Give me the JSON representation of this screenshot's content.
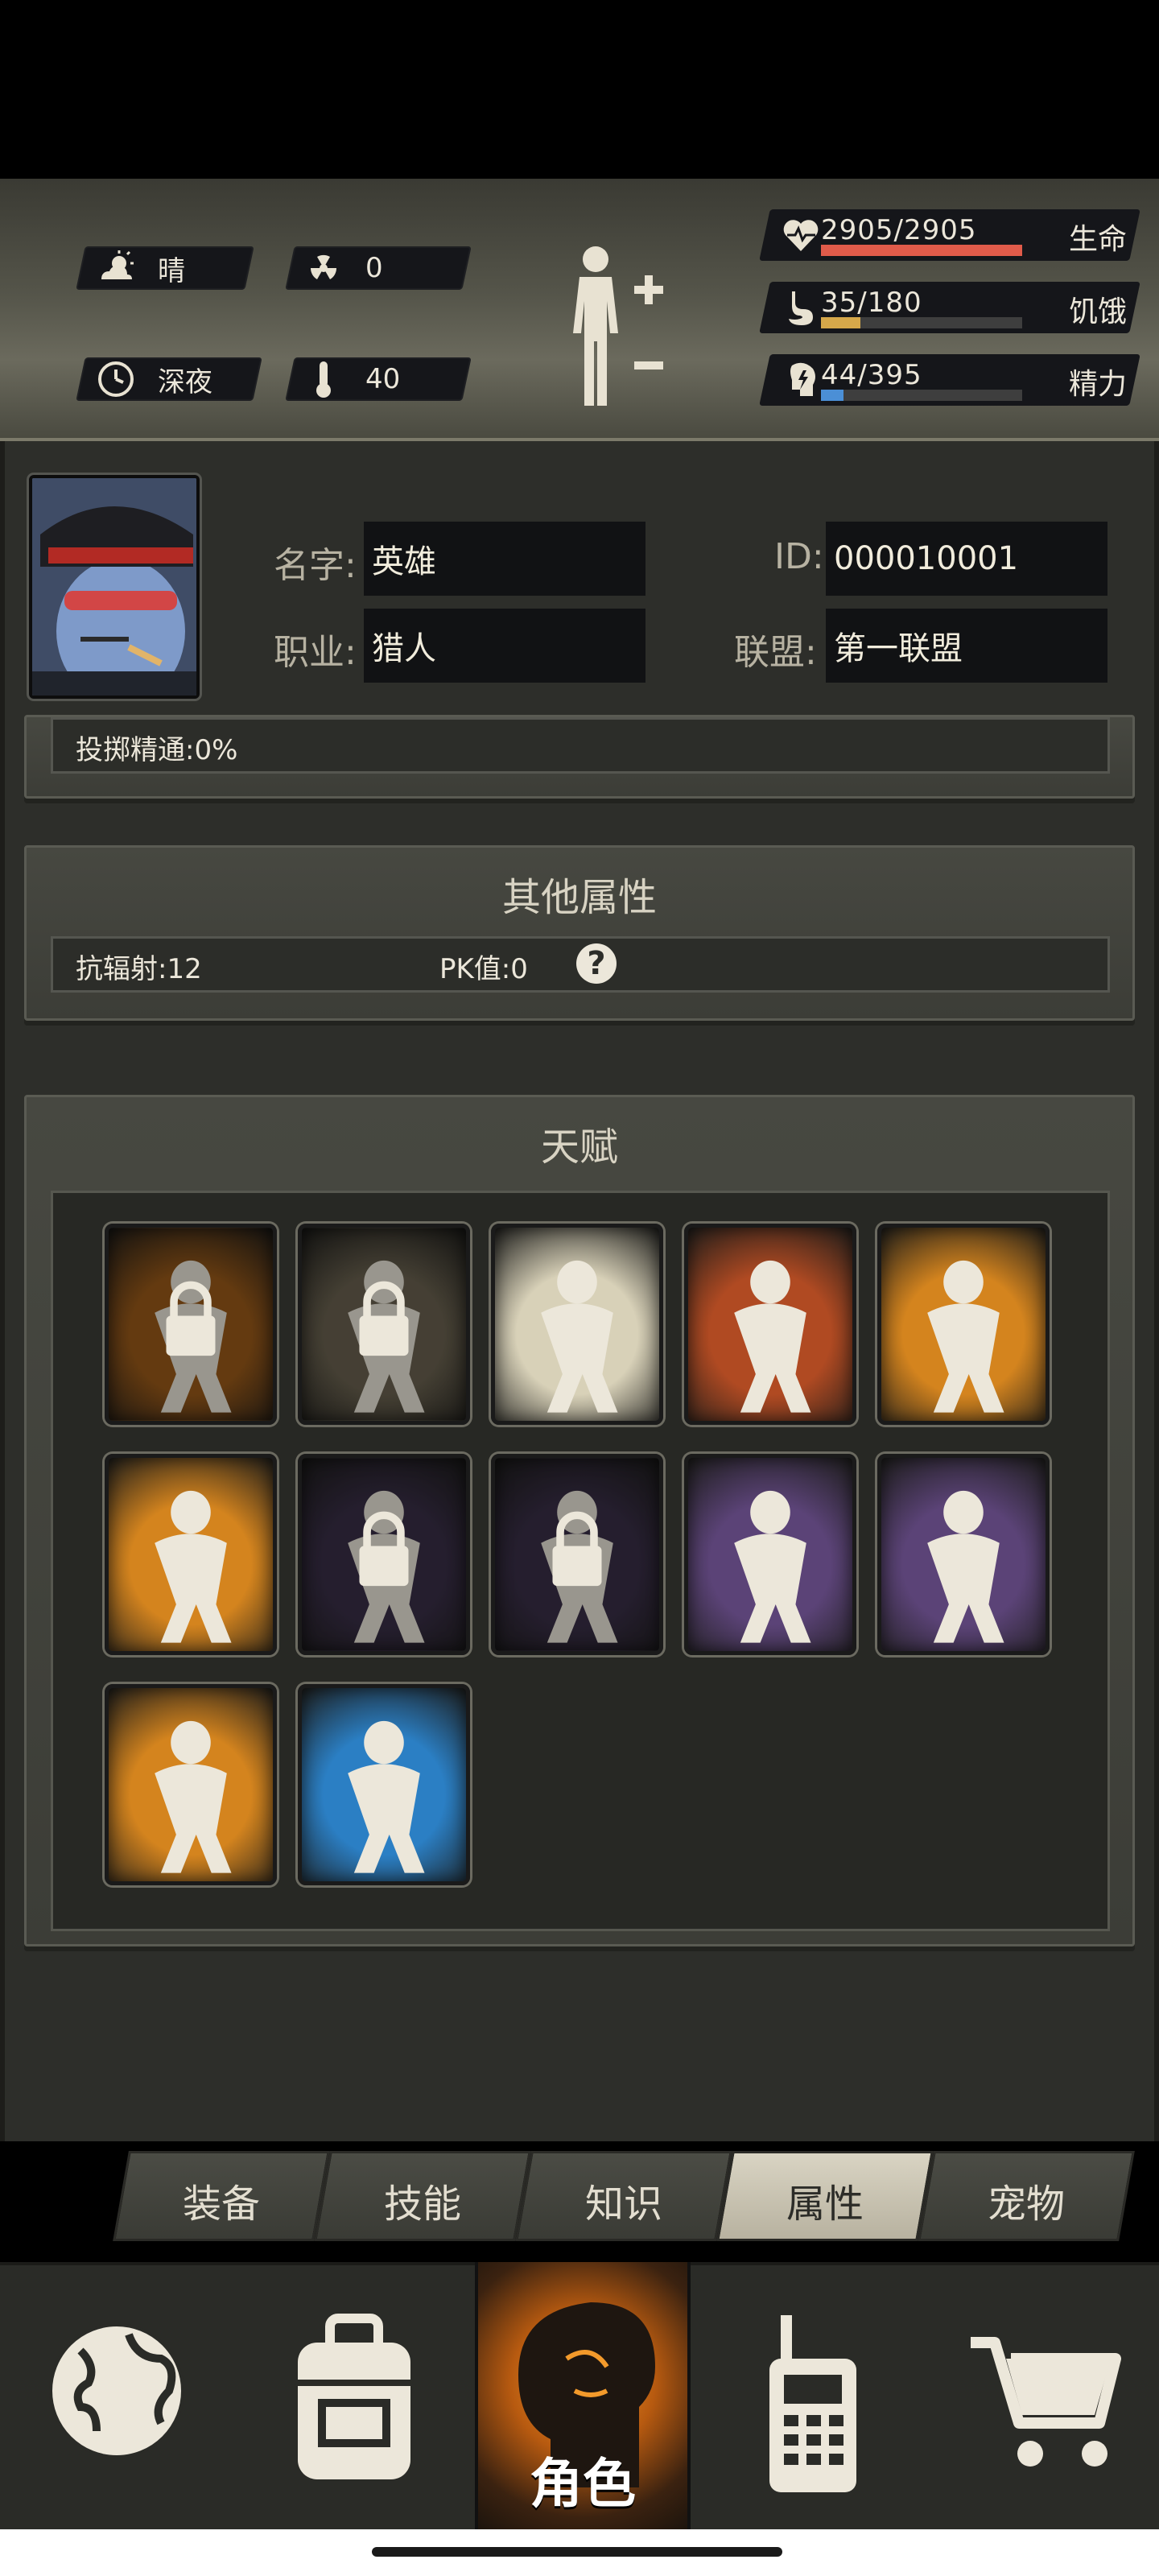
{
  "status": {
    "weather": "晴",
    "radiation": "0",
    "time_of_day": "深夜",
    "temperature": "40",
    "stats": [
      {
        "name": "生命",
        "value": "2905/2905",
        "fraction": 1.0,
        "color": "#e05b4a",
        "icon": "heart-pulse-icon"
      },
      {
        "name": "饥饿",
        "value": "35/180",
        "fraction": 0.194,
        "color": "#d6a84a",
        "icon": "stomach-icon"
      },
      {
        "name": "精力",
        "value": "44/395",
        "fraction": 0.111,
        "color": "#4b8fd6",
        "icon": "brain-energy-icon"
      }
    ]
  },
  "profile": {
    "name_label": "名字",
    "name": "英雄",
    "job_label": "职业",
    "job": "猎人",
    "id_label": "ID",
    "id": "000010001",
    "alliance_label": "联盟",
    "alliance": "第一联盟",
    "partial_row": "投掷精通:0%"
  },
  "other_attributes": {
    "title": "其他属性",
    "radiation_resist": "抗辐射:12",
    "pk_value": "PK值:0",
    "help": "?"
  },
  "talents": {
    "title": "天赋",
    "items": [
      {
        "name": "porter",
        "locked": true,
        "bg": "#9a5a1a"
      },
      {
        "name": "panda",
        "locked": true,
        "bg": "#6a6250"
      },
      {
        "name": "eater",
        "locked": false,
        "bg": "#d8d1b8"
      },
      {
        "name": "fist",
        "locked": false,
        "bg": "#b04a22"
      },
      {
        "name": "strongman",
        "locked": false,
        "bg": "#d4841e"
      },
      {
        "name": "boxer",
        "locked": false,
        "bg": "#d4841e"
      },
      {
        "name": "pistol",
        "locked": true,
        "bg": "#3a2f48"
      },
      {
        "name": "rifle",
        "locked": true,
        "bg": "#3a2f48"
      },
      {
        "name": "archer",
        "locked": false,
        "bg": "#5b4377"
      },
      {
        "name": "shield",
        "locked": false,
        "bg": "#5b4377"
      },
      {
        "name": "kick",
        "locked": false,
        "bg": "#d4841e"
      },
      {
        "name": "crouch",
        "locked": false,
        "bg": "#2b7fc4"
      }
    ]
  },
  "tabs": [
    {
      "label": "装备",
      "active": false
    },
    {
      "label": "技能",
      "active": false
    },
    {
      "label": "知识",
      "active": false
    },
    {
      "label": "属性",
      "active": true
    },
    {
      "label": "宠物",
      "active": false
    }
  ],
  "nav": {
    "role_label": "角色",
    "items": [
      "globe-icon",
      "backpack-icon",
      "role-icon",
      "walkie-talkie-icon",
      "cart-icon"
    ]
  }
}
